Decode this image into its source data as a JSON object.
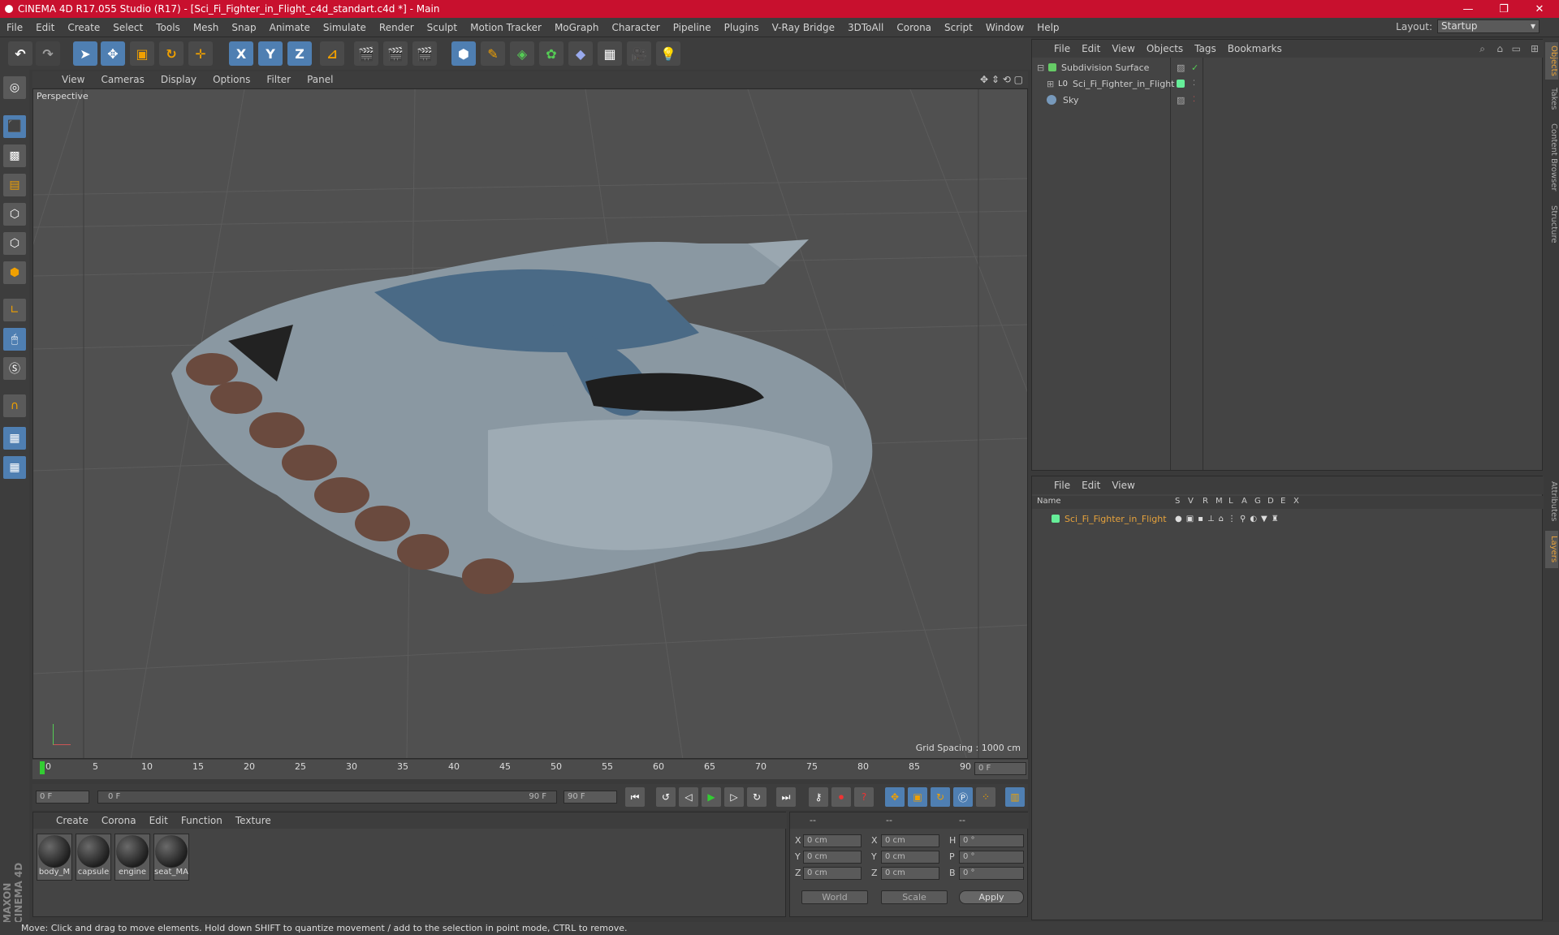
{
  "window": {
    "title": "CINEMA 4D R17.055 Studio (R17) - [Sci_Fi_Fighter_in_Flight_c4d_standart.c4d *] - Main",
    "minimize": "—",
    "maximize": "❐",
    "close": "✕"
  },
  "menu": [
    "File",
    "Edit",
    "Create",
    "Select",
    "Tools",
    "Mesh",
    "Snap",
    "Animate",
    "Simulate",
    "Render",
    "Sculpt",
    "Motion Tracker",
    "MoGraph",
    "Character",
    "Pipeline",
    "Plugins",
    "V-Ray Bridge",
    "3DToAll",
    "Corona",
    "Script",
    "Window",
    "Help"
  ],
  "layout": {
    "label": "Layout:",
    "value": "Startup"
  },
  "toolbar": {
    "x": "X",
    "y": "Y",
    "z": "Z"
  },
  "viewport": {
    "menu": [
      "View",
      "Cameras",
      "Display",
      "Options",
      "Filter",
      "Panel"
    ],
    "label": "Perspective",
    "grid_spacing": "Grid Spacing : 1000 cm"
  },
  "timeline": {
    "ticks": [
      "0",
      "5",
      "10",
      "15",
      "20",
      "25",
      "30",
      "35",
      "40",
      "45",
      "50",
      "55",
      "60",
      "65",
      "70",
      "75",
      "80",
      "85",
      "90"
    ],
    "frame_field": "0 F",
    "start_field": "0 F",
    "range_start": "0 F",
    "range_end": "90 F",
    "end_field": "90 F"
  },
  "materials": {
    "menu": [
      "Create",
      "Corona",
      "Edit",
      "Function",
      "Texture"
    ],
    "items": [
      "body_M",
      "capsule",
      "engine",
      "seat_MA"
    ]
  },
  "coords": {
    "headers": [
      "--",
      "--",
      "--"
    ],
    "rows": [
      {
        "a": "X",
        "av": "0 cm",
        "b": "X",
        "bv": "0 cm",
        "c": "H",
        "cv": "0 °"
      },
      {
        "a": "Y",
        "av": "0 cm",
        "b": "Y",
        "bv": "0 cm",
        "c": "P",
        "cv": "0 °"
      },
      {
        "a": "Z",
        "av": "0 cm",
        "b": "Z",
        "bv": "0 cm",
        "c": "B",
        "cv": "0 °"
      }
    ],
    "world": "World",
    "scale": "Scale",
    "apply": "Apply"
  },
  "objects": {
    "menu": [
      "File",
      "Edit",
      "View",
      "Objects",
      "Tags",
      "Bookmarks"
    ],
    "items": [
      "Subdivision Surface",
      "Sci_Fi_Fighter_in_Flight",
      "Sky"
    ]
  },
  "layers": {
    "menu": [
      "File",
      "Edit",
      "View"
    ],
    "name_header": "Name",
    "cols": [
      "S",
      "V",
      "R",
      "M",
      "L",
      "A",
      "G",
      "D",
      "E",
      "X"
    ],
    "item": "Sci_Fi_Fighter_in_Flight"
  },
  "right_tabs": [
    "Objects",
    "Takes",
    "Content Browser",
    "Structure",
    "Attributes",
    "Layers"
  ],
  "brand": "MAXON CINEMA 4D",
  "status": "Move: Click and drag to move elements. Hold down SHIFT to quantize movement / add to the selection in point mode, CTRL to remove.",
  "colors": {
    "titlebar": "#c8102e",
    "accent": "#4f7fb2",
    "layer_name": "#e6a23c"
  }
}
